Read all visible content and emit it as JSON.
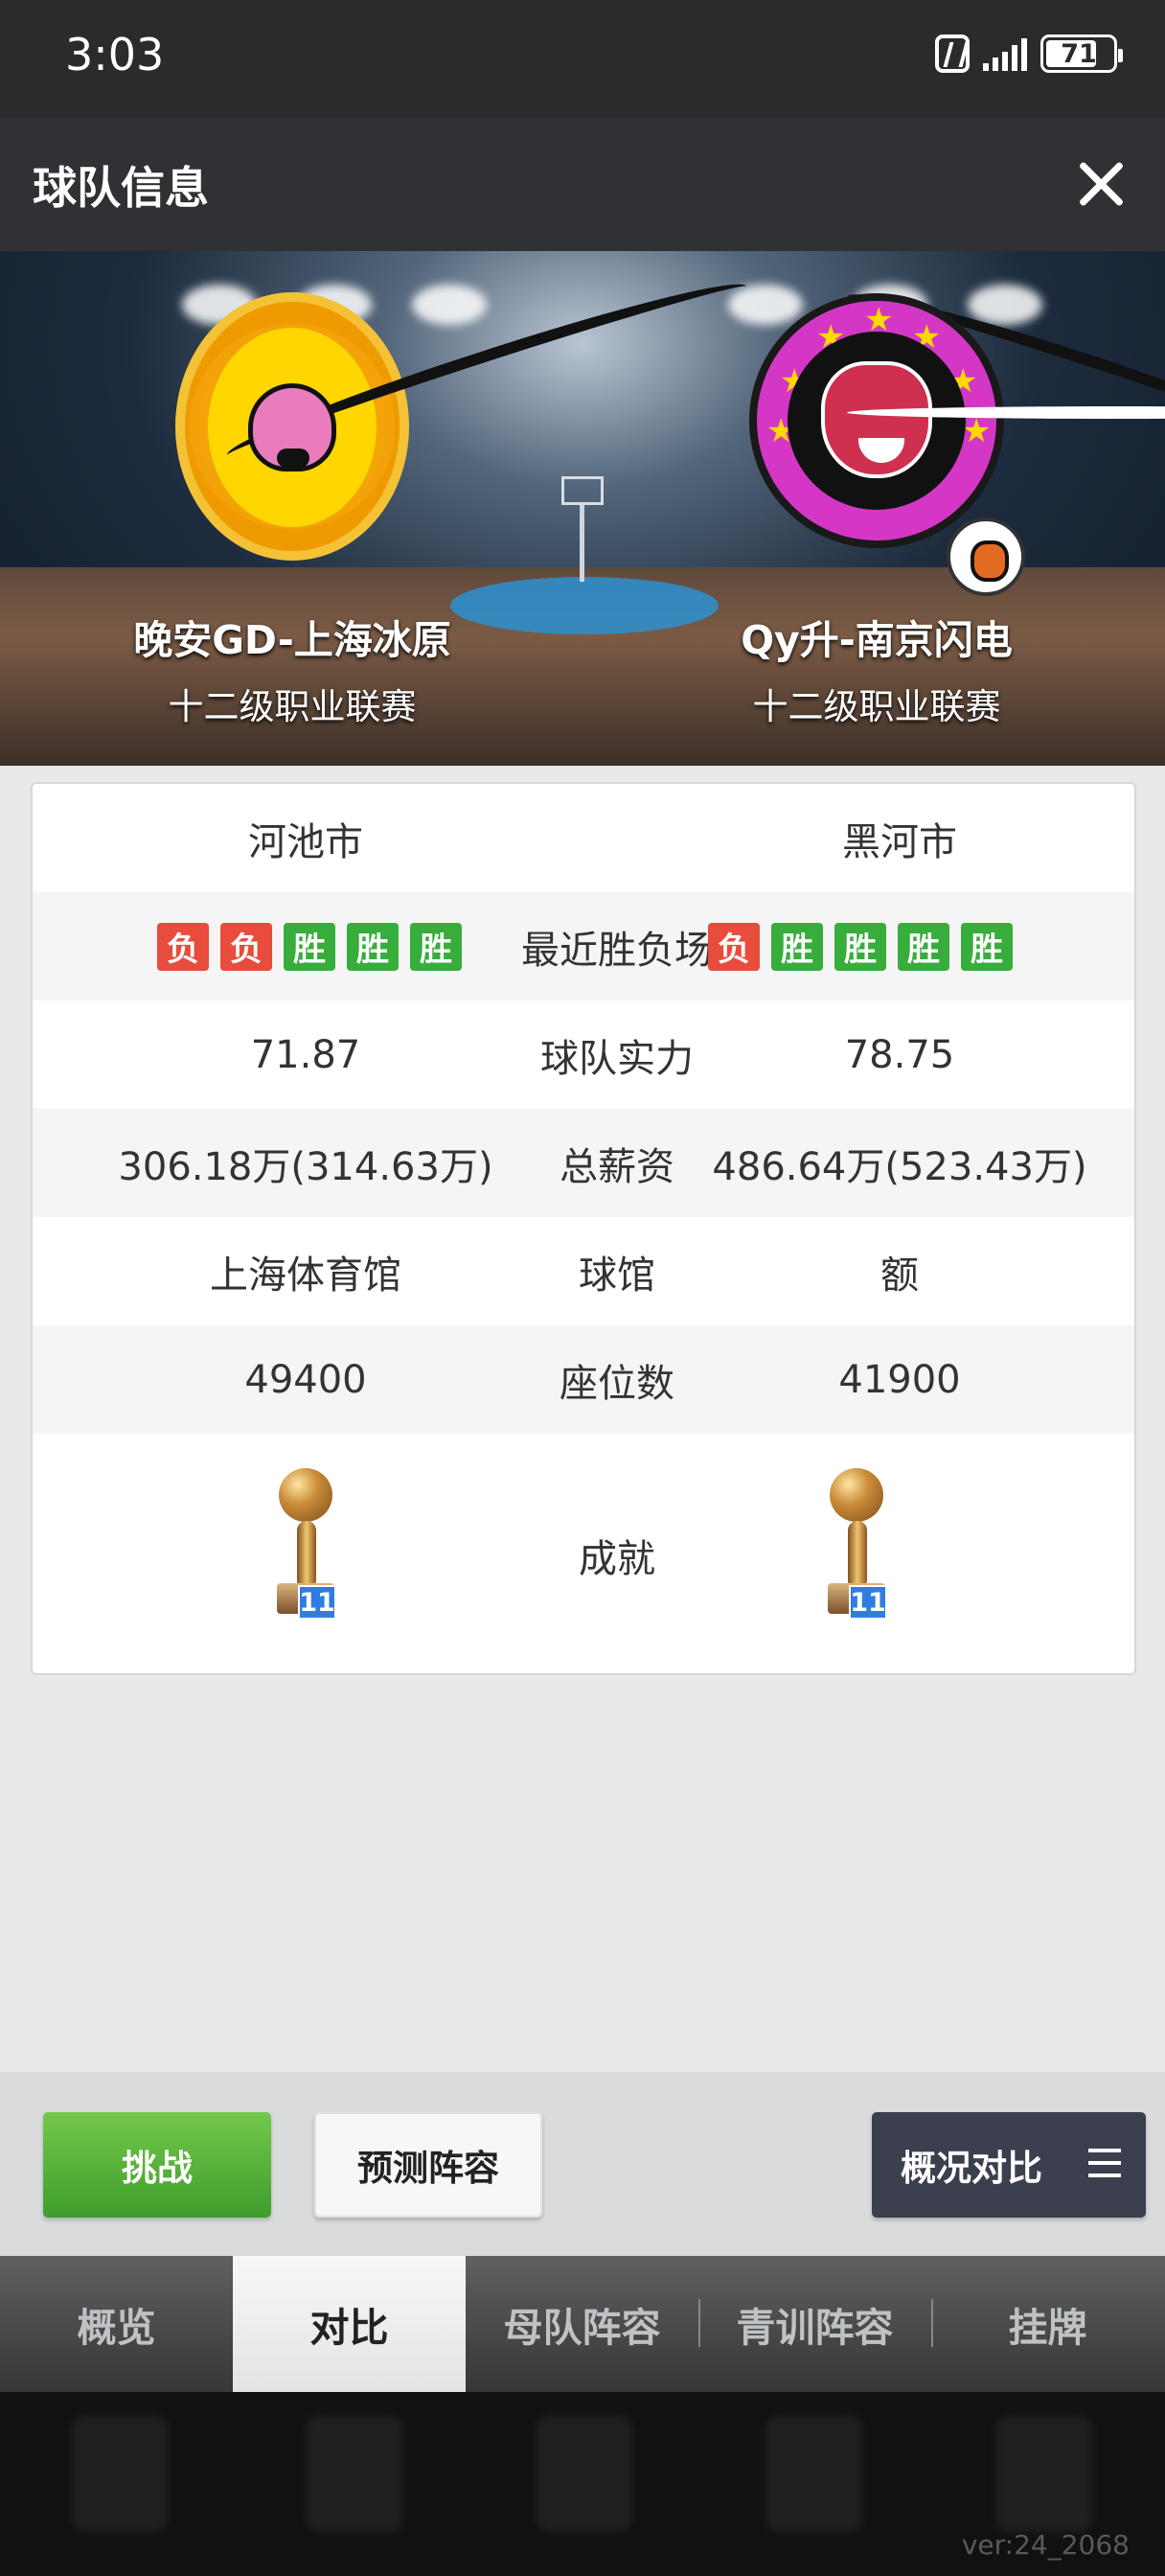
{
  "status_bar": {
    "time": "3:03",
    "battery": "71",
    "icons": [
      "nfc-icon",
      "signal-icon",
      "battery-icon"
    ]
  },
  "header": {
    "title": "球队信息",
    "close_icon": "close-icon"
  },
  "teams": {
    "home": {
      "name": "晚安GD-上海冰原",
      "league": "十二级职业联赛",
      "logo": "bull-logo"
    },
    "away": {
      "name": "Qy升-南京闪电",
      "league": "十二级职业联赛",
      "logo": "tiger-logo"
    }
  },
  "comparison": {
    "city": {
      "home": "河池市",
      "away": "黑河市"
    },
    "recent_results": {
      "label": "最近胜负场",
      "home": [
        "负",
        "负",
        "胜",
        "胜",
        "胜"
      ],
      "away": [
        "负",
        "胜",
        "胜",
        "胜",
        "胜"
      ]
    },
    "strength": {
      "home": "71.87",
      "label": "球队实力",
      "away": "78.75"
    },
    "salary": {
      "home": "306.18万(314.63万)",
      "label": "总薪资",
      "away": "486.64万(523.43万)"
    },
    "arena": {
      "home": "上海体育馆",
      "label": "球馆",
      "away": "额"
    },
    "seats": {
      "home": "49400",
      "label": "座位数",
      "away": "41900"
    },
    "achievements": {
      "label": "成就",
      "home_count": "11",
      "away_count": "11"
    }
  },
  "actions": {
    "challenge": "挑战",
    "predict": "预测阵容",
    "compare": "概况对比"
  },
  "tabs": [
    {
      "label": "概览"
    },
    {
      "label": "对比"
    },
    {
      "label": "母队阵容"
    },
    {
      "label": "青训阵容"
    },
    {
      "label": "挂牌"
    }
  ],
  "version": "ver:24_2068",
  "colors": {
    "win": "#37ad3c",
    "loss": "#e74c3c",
    "challenge": "#4fab31",
    "compare": "#3b3f4e"
  }
}
